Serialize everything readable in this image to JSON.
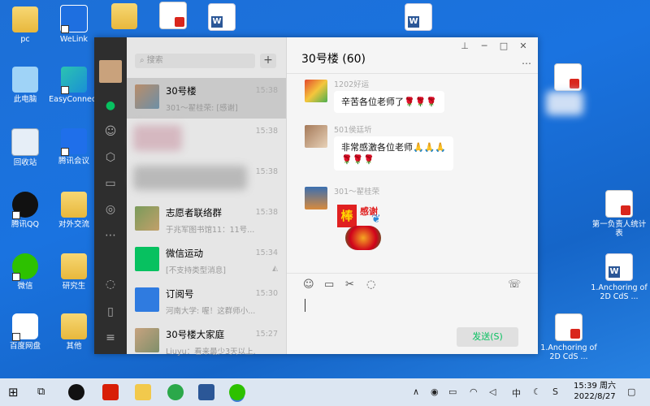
{
  "desktop": {
    "left_icons": [
      {
        "label": "pc",
        "icon": "user-folder-icon"
      },
      {
        "label": "此电脑",
        "icon": "computer-icon"
      },
      {
        "label": "回收站",
        "icon": "recycle-bin-icon"
      },
      {
        "label": "腾讯QQ",
        "icon": "qq-icon"
      },
      {
        "label": "微信",
        "icon": "wechat-icon"
      },
      {
        "label": "百度网盘",
        "icon": "baidu-netdisk-icon"
      }
    ],
    "col2_icons": [
      {
        "label": "WeLink",
        "icon": "welink-icon"
      },
      {
        "label": "EasyConnect",
        "icon": "easyconnect-icon"
      },
      {
        "label": "腾讯会议",
        "icon": "tencent-meeting-icon"
      },
      {
        "label": "对外交流",
        "icon": "folder-icon"
      },
      {
        "label": "研究生",
        "icon": "folder-icon"
      },
      {
        "label": "其他",
        "icon": "folder-icon"
      }
    ],
    "right_icons": [
      {
        "label": "第一负责人统计表",
        "icon": "pdf-icon"
      },
      {
        "label": "1.Anchoring of 2D CdS ...",
        "icon": "word-icon"
      },
      {
        "label": "1.Anchoring of 2D CdS ...",
        "icon": "pdf-icon"
      }
    ]
  },
  "wechat": {
    "search_placeholder": "搜索",
    "add_label": "+",
    "conversations": [
      {
        "name": "30号楼",
        "preview": "301～翟桂荣: [感谢]",
        "time": "15:38",
        "selected": true
      },
      {
        "name": "",
        "preview": "",
        "time": "15:38"
      },
      {
        "name": "",
        "preview": "",
        "time": "15:38"
      },
      {
        "name": "志愿者联络群",
        "preview": "于兆军图书馆11：11号...",
        "time": "15:38"
      },
      {
        "name": "微信运动",
        "preview": "[不支持类型消息]",
        "time": "15:34"
      },
      {
        "name": "订阅号",
        "preview": "河南大学: 喔！这群师小...",
        "time": "15:30"
      },
      {
        "name": "30号楼大家庭",
        "preview": "Liuyu：看来最少3天以上...",
        "time": "15:27"
      }
    ],
    "chat_title": "30号楼 (60)",
    "messages": [
      {
        "sender": "1202好运",
        "text": "辛苦各位老师了🌹🌹🌹"
      },
      {
        "sender": "501侯廷圻",
        "text": "非常感激各位老师🙏🙏🙏",
        "text2": "🌹🌹🌹"
      },
      {
        "sender": "301～翟桂荣",
        "sticker_text1": "棒",
        "sticker_text2": "感谢"
      }
    ],
    "send_label": "发送(S)",
    "more_label": "…"
  },
  "taskbar": {
    "time": "15:39 周六",
    "date": "2022/8/27"
  }
}
